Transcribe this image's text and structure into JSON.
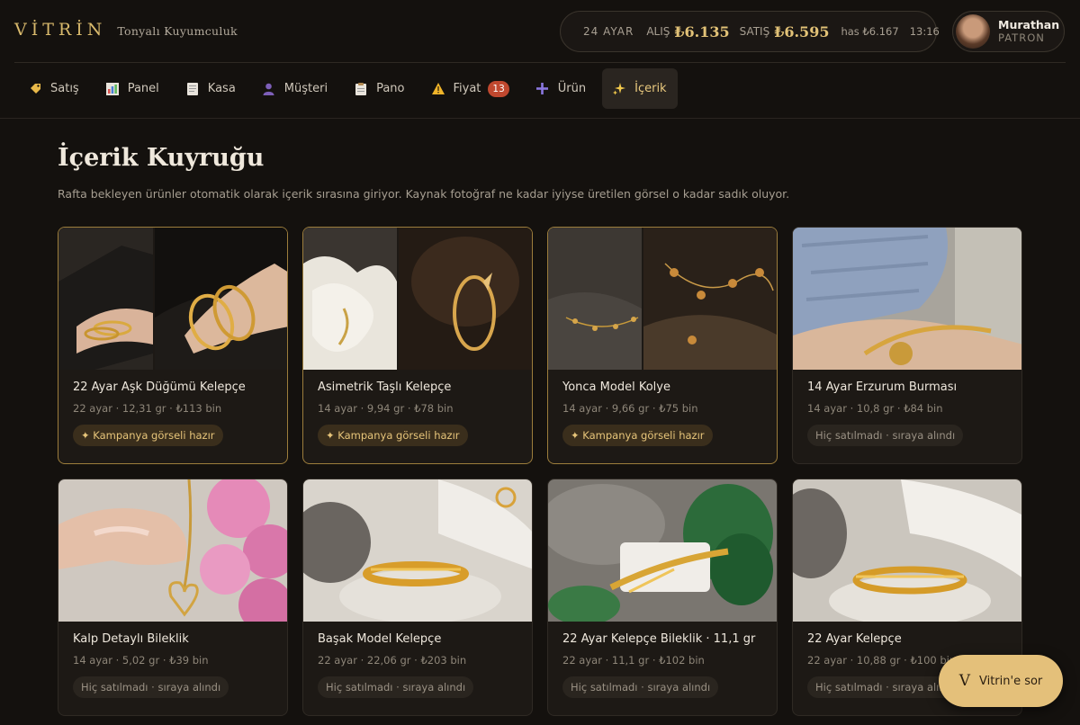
{
  "brand": {
    "logo": "VİTRİN",
    "subtitle": "Tonyalı Kuyumculuk"
  },
  "ticker": {
    "karat": "24 AYAR",
    "buy_label": "ALIŞ",
    "buy_price": "₺6.135",
    "sell_label": "SATIŞ",
    "sell_price": "₺6.595",
    "has_price": "has ₺6.167",
    "time": "13:16"
  },
  "user": {
    "name": "Murathan",
    "role": "PATRON"
  },
  "nav": [
    {
      "label": "Satış",
      "icon": "tag-icon"
    },
    {
      "label": "Panel",
      "icon": "bar-chart-icon"
    },
    {
      "label": "Kasa",
      "icon": "receipt-icon"
    },
    {
      "label": "Müşteri",
      "icon": "person-icon"
    },
    {
      "label": "Pano",
      "icon": "clipboard-icon"
    },
    {
      "label": "Fiyat",
      "icon": "warning-icon",
      "badge": "13"
    },
    {
      "label": "Ürün",
      "icon": "plus-icon"
    },
    {
      "label": "İçerik",
      "icon": "sparkles-icon",
      "active": true
    }
  ],
  "page": {
    "title": "İçerik Kuyruğu",
    "description": "Rafta bekleyen ürünler otomatik olarak içerik sırasına giriyor. Kaynak fotoğraf ne kadar iyiyse üretilen görsel o kadar sadık oluyor."
  },
  "cards": [
    {
      "title": "22 Ayar Aşk Düğümü Kelepçe",
      "meta": "22 ayar · 12,31 gr · ₺113 bin",
      "tag": "✦ Kampanya görseli hazır",
      "ready": true
    },
    {
      "title": "Asimetrik Taşlı Kelepçe",
      "meta": "14 ayar · 9,94 gr · ₺78 bin",
      "tag": "✦ Kampanya görseli hazır",
      "ready": true
    },
    {
      "title": "Yonca Model Kolye",
      "meta": "14 ayar · 9,66 gr · ₺75 bin",
      "tag": "✦ Kampanya görseli hazır",
      "ready": true
    },
    {
      "title": "14 Ayar Erzurum Burması",
      "meta": "14 ayar · 10,8 gr · ₺84 bin",
      "tag": "Hiç satılmadı · sıraya alındı",
      "ready": false
    },
    {
      "title": "Kalp Detaylı Bileklik",
      "meta": "14 ayar · 5,02 gr · ₺39 bin",
      "tag": "Hiç satılmadı · sıraya alındı",
      "ready": false
    },
    {
      "title": "Başak Model Kelepçe",
      "meta": "22 ayar · 22,06 gr · ₺203 bin",
      "tag": "Hiç satılmadı · sıraya alındı",
      "ready": false
    },
    {
      "title": "22 Ayar Kelepçe Bileklik · 11,1 gr",
      "meta": "22 ayar · 11,1 gr · ₺102 bin",
      "tag": "Hiç satılmadı · sıraya alındı",
      "ready": false
    },
    {
      "title": "22 Ayar Kelepçe",
      "meta": "22 ayar · 10,88 gr · ₺100 bin",
      "tag": "Hiç satılmadı · sıraya alındı",
      "ready": false
    }
  ],
  "assistant": {
    "label": "Vitrin'e sor",
    "mark": "V"
  },
  "colors": {
    "accent": "#e4c07a",
    "gold_text": "#d8b96c",
    "badge": "#c0482f",
    "background": "#14110e"
  }
}
